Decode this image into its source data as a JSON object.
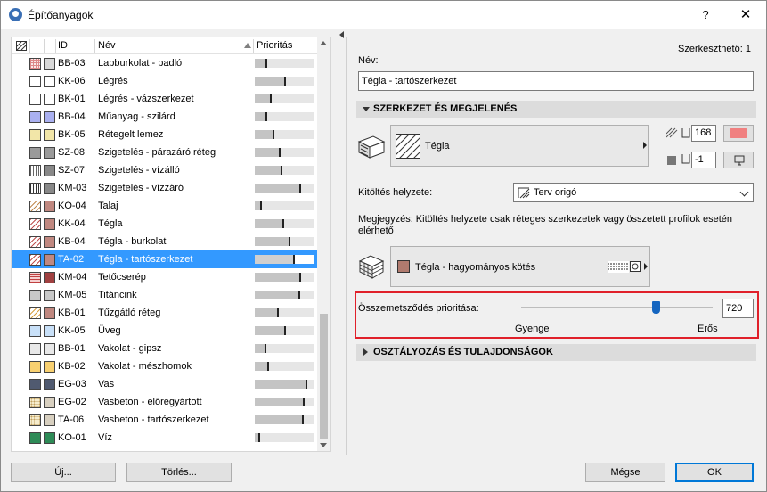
{
  "window": {
    "title": "Építőanyagok",
    "help_label": "?",
    "close_label": "✕"
  },
  "list": {
    "headers": {
      "id": "ID",
      "name": "Név",
      "priority": "Prioritás"
    },
    "rows": [
      {
        "id": "BB-03",
        "name": "Lapburkolat - padló",
        "fg": "#d88",
        "bg": "#fff",
        "pat": "grid",
        "prio": 0.22
      },
      {
        "id": "KK-06",
        "name": "Légrés",
        "fg": "#fff",
        "bg": "#fff",
        "pat": "none",
        "prio": 0.55
      },
      {
        "id": "BK-01",
        "name": "Légrés - vázszerkezet",
        "fg": "#fff",
        "bg": "#fff",
        "pat": "none",
        "prio": 0.3
      },
      {
        "id": "BB-04",
        "name": "Műanyag - szilárd",
        "fg": "#aab0f0",
        "bg": "#fff",
        "pat": "solid",
        "prio": 0.22
      },
      {
        "id": "BK-05",
        "name": "Rétegelt lemez",
        "fg": "#f2e6a8",
        "bg": "#fff",
        "pat": "solid",
        "prio": 0.35
      },
      {
        "id": "SZ-08",
        "name": "Szigetelés - párazáró réteg",
        "fg": "#9a9a9a",
        "bg": "#fff",
        "pat": "solid",
        "prio": 0.45
      },
      {
        "id": "SZ-07",
        "name": "Szigetelés - vízálló",
        "fg": "#666",
        "bg": "#fff",
        "pat": "vlines",
        "prio": 0.48
      },
      {
        "id": "KM-03",
        "name": "Szigetelés - vízzáró",
        "fg": "#333",
        "bg": "#fff",
        "pat": "vlines",
        "prio": 0.82
      },
      {
        "id": "KO-04",
        "name": "Talaj",
        "fg": "#c08a50",
        "bg": "#fff",
        "pat": "diag",
        "prio": 0.12
      },
      {
        "id": "KK-04",
        "name": "Tégla",
        "fg": "#c05050",
        "bg": "#fff",
        "pat": "diag",
        "prio": 0.52
      },
      {
        "id": "KB-04",
        "name": "Tégla - burkolat",
        "fg": "#c05050",
        "bg": "#fff",
        "pat": "diag",
        "prio": 0.62
      },
      {
        "id": "TA-02",
        "name": "Tégla - tartószerkezet",
        "fg": "#c05050",
        "bg": "#fff",
        "pat": "diag",
        "prio": 0.7,
        "selected": true
      },
      {
        "id": "KM-04",
        "name": "Tetőcserép",
        "fg": "#c04040",
        "bg": "#fff",
        "pat": "hlines",
        "prio": 0.82
      },
      {
        "id": "KM-05",
        "name": "Titáncink",
        "fg": "#c8c8c8",
        "bg": "#fff",
        "pat": "solid",
        "prio": 0.8
      },
      {
        "id": "KB-01",
        "name": "Tűzgátló réteg",
        "fg": "#d8a040",
        "bg": "#fff",
        "pat": "diag",
        "prio": 0.42
      },
      {
        "id": "KK-05",
        "name": "Üveg",
        "fg": "#c8e0f8",
        "bg": "#fff",
        "pat": "solid",
        "prio": 0.55
      },
      {
        "id": "BB-01",
        "name": "Vakolat - gipsz",
        "fg": "#e8e8e8",
        "bg": "#fff",
        "pat": "solid",
        "prio": 0.2
      },
      {
        "id": "KB-02",
        "name": "Vakolat - mészhomok",
        "fg": "#f8d070",
        "bg": "#fff",
        "pat": "solid",
        "prio": 0.25
      },
      {
        "id": "EG-03",
        "name": "Vas",
        "fg": "#505a70",
        "bg": "#fff",
        "pat": "solid",
        "prio": 0.92
      },
      {
        "id": "EG-02",
        "name": "Vasbeton - előregyártott",
        "fg": "#c0a060",
        "bg": "#fff",
        "pat": "dots",
        "prio": 0.88
      },
      {
        "id": "TA-06",
        "name": "Vasbeton - tartószerkezet",
        "fg": "#c0a060",
        "bg": "#fff",
        "pat": "dots",
        "prio": 0.86
      },
      {
        "id": "KO-01",
        "name": "Víz",
        "fg": "#2e8b57",
        "bg": "#fff",
        "pat": "solid",
        "prio": 0.1
      }
    ]
  },
  "buttons": {
    "new": "Új...",
    "delete": "Törlés...",
    "cancel": "Mégse",
    "ok": "OK"
  },
  "editor": {
    "editable": "Szerkeszthető: 1",
    "name_label": "Név:",
    "name_value": "Tégla - tartószerkezet",
    "section1": "SZERKEZET ÉS MEGJELENÉS",
    "fill_name": "Tégla",
    "pen1": "168",
    "pen2": "-1",
    "fill_origin_label": "Kitöltés helyzete:",
    "fill_origin_value": "Terv origó",
    "note": "Megjegyzés: Kitöltés helyzete csak réteges szerkezetek vagy összetett profilok esetén elérhető",
    "surface_name": "Tégla - hagyományos kötés",
    "surface_color": "#b07a6e",
    "priority_label": "Összemetsződés prioritása:",
    "priority_value": "720",
    "priority_fraction": 0.7,
    "weak": "Gyenge",
    "strong": "Erős",
    "section2": "OSZTÁLYOZÁS ÉS TULAJDONSÁGOK",
    "accent_red": "#f08080"
  }
}
